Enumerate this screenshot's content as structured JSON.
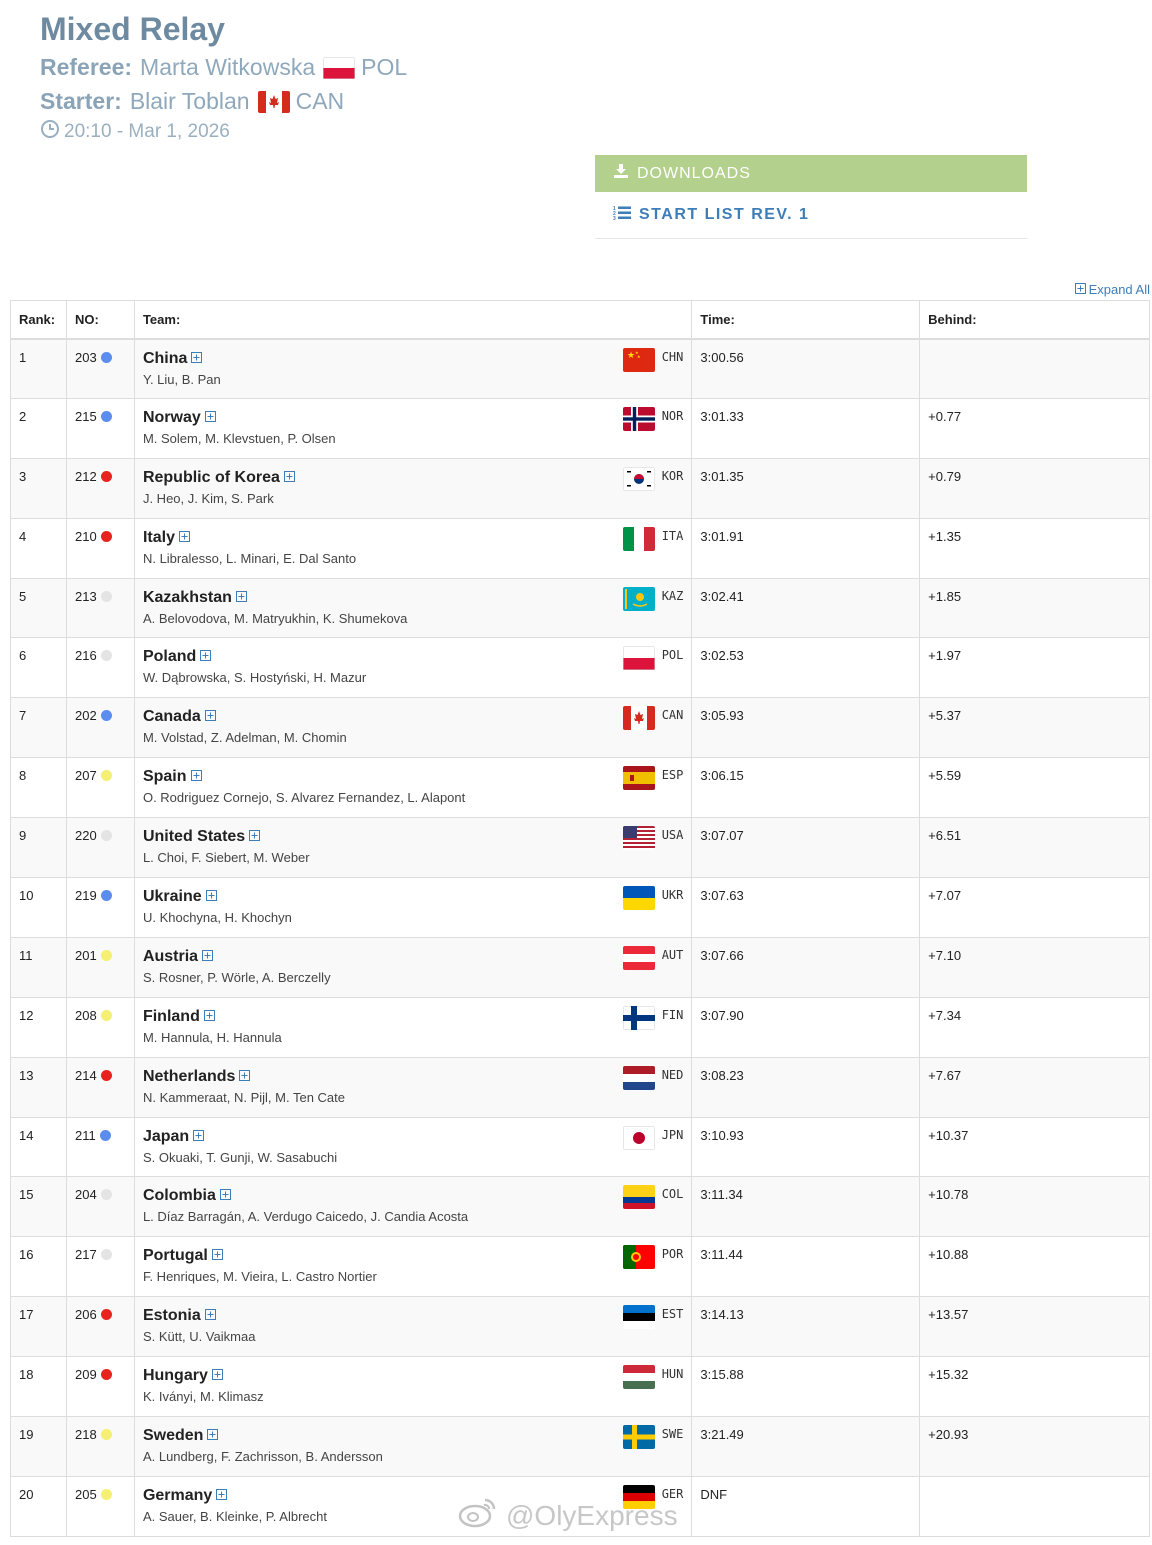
{
  "event": {
    "title": "Mixed Relay",
    "referee_label": "Referee:",
    "referee_name": "Marta Witkowska",
    "referee_country": "POL",
    "starter_label": "Starter:",
    "starter_name": "Blair Toblan",
    "starter_country": "CAN",
    "datetime": "20:10 - Mar 1, 2026"
  },
  "downloads": {
    "heading": "DOWNLOADS",
    "start_list": "START LIST REV. 1"
  },
  "expand_all": "Expand All",
  "table": {
    "headers": {
      "rank": "Rank:",
      "no": "NO:",
      "team": "Team:",
      "time": "Time:",
      "behind": "Behind:"
    },
    "rows": [
      {
        "rank": "1",
        "no": "203",
        "dot": "#5b8def",
        "team": "China",
        "members": "Y. Liu, B. Pan",
        "code": "CHN",
        "time": "3:00.56",
        "behind": ""
      },
      {
        "rank": "2",
        "no": "215",
        "dot": "#5b8def",
        "team": "Norway",
        "members": "M. Solem, M. Klevstuen, P. Olsen",
        "code": "NOR",
        "time": "3:01.33",
        "behind": "+0.77"
      },
      {
        "rank": "3",
        "no": "212",
        "dot": "#e8231d",
        "team": "Republic of Korea",
        "members": "J. Heo, J. Kim, S. Park",
        "code": "KOR",
        "time": "3:01.35",
        "behind": "+0.79"
      },
      {
        "rank": "4",
        "no": "210",
        "dot": "#e8231d",
        "team": "Italy",
        "members": "N. Libralesso, L. Minari, E. Dal Santo",
        "code": "ITA",
        "time": "3:01.91",
        "behind": "+1.35"
      },
      {
        "rank": "5",
        "no": "213",
        "dot": "#e4e4e4",
        "team": "Kazakhstan",
        "members": "A. Belovodova, M. Matryukhin, K. Shumekova",
        "code": "KAZ",
        "time": "3:02.41",
        "behind": "+1.85"
      },
      {
        "rank": "6",
        "no": "216",
        "dot": "#e4e4e4",
        "team": "Poland",
        "members": "W. Dąbrowska, S. Hostyński, H. Mazur",
        "code": "POL",
        "time": "3:02.53",
        "behind": "+1.97"
      },
      {
        "rank": "7",
        "no": "202",
        "dot": "#5b8def",
        "team": "Canada",
        "members": "M. Volstad, Z. Adelman, M. Chomin",
        "code": "CAN",
        "time": "3:05.93",
        "behind": "+5.37"
      },
      {
        "rank": "8",
        "no": "207",
        "dot": "#f5ef73",
        "team": "Spain",
        "members": "O. Rodriguez Cornejo, S. Alvarez Fernandez, L. Alapont",
        "code": "ESP",
        "time": "3:06.15",
        "behind": "+5.59"
      },
      {
        "rank": "9",
        "no": "220",
        "dot": "#e4e4e4",
        "team": "United States",
        "members": "L. Choi, F. Siebert, M. Weber",
        "code": "USA",
        "time": "3:07.07",
        "behind": "+6.51"
      },
      {
        "rank": "10",
        "no": "219",
        "dot": "#5b8def",
        "team": "Ukraine",
        "members": "U. Khochyna, H. Khochyn",
        "code": "UKR",
        "time": "3:07.63",
        "behind": "+7.07"
      },
      {
        "rank": "11",
        "no": "201",
        "dot": "#f5ef73",
        "team": "Austria",
        "members": "S. Rosner, P. Wörle, A. Berczelly",
        "code": "AUT",
        "time": "3:07.66",
        "behind": "+7.10"
      },
      {
        "rank": "12",
        "no": "208",
        "dot": "#f5ef73",
        "team": "Finland",
        "members": "M. Hannula, H. Hannula",
        "code": "FIN",
        "time": "3:07.90",
        "behind": "+7.34"
      },
      {
        "rank": "13",
        "no": "214",
        "dot": "#e8231d",
        "team": "Netherlands",
        "members": "N. Kammeraat, N. Pijl, M. Ten Cate",
        "code": "NED",
        "time": "3:08.23",
        "behind": "+7.67"
      },
      {
        "rank": "14",
        "no": "211",
        "dot": "#5b8def",
        "team": "Japan",
        "members": "S. Okuaki, T. Gunji, W. Sasabuchi",
        "code": "JPN",
        "time": "3:10.93",
        "behind": "+10.37"
      },
      {
        "rank": "15",
        "no": "204",
        "dot": "#e4e4e4",
        "team": "Colombia",
        "members": "L. Díaz Barragán, A. Verdugo Caicedo, J. Candia Acosta",
        "code": "COL",
        "time": "3:11.34",
        "behind": "+10.78"
      },
      {
        "rank": "16",
        "no": "217",
        "dot": "#e4e4e4",
        "team": "Portugal",
        "members": "F. Henriques, M. Vieira, L. Castro Nortier",
        "code": "POR",
        "time": "3:11.44",
        "behind": "+10.88"
      },
      {
        "rank": "17",
        "no": "206",
        "dot": "#e8231d",
        "team": "Estonia",
        "members": "S. Kütt, U. Vaikmaa",
        "code": "EST",
        "time": "3:14.13",
        "behind": "+13.57"
      },
      {
        "rank": "18",
        "no": "209",
        "dot": "#e8231d",
        "team": "Hungary",
        "members": "K. Iványi, M. Klimasz",
        "code": "HUN",
        "time": "3:15.88",
        "behind": "+15.32"
      },
      {
        "rank": "19",
        "no": "218",
        "dot": "#f5ef73",
        "team": "Sweden",
        "members": "A. Lundberg, F. Zachrisson, B. Andersson",
        "code": "SWE",
        "time": "3:21.49",
        "behind": "+20.93"
      },
      {
        "rank": "20",
        "no": "205",
        "dot": "#f5ef73",
        "team": "Germany",
        "members": "A. Sauer, B. Kleinke, P. Albrecht",
        "code": "GER",
        "time": "DNF",
        "behind": ""
      }
    ]
  },
  "watermark": "@OlyExpress"
}
